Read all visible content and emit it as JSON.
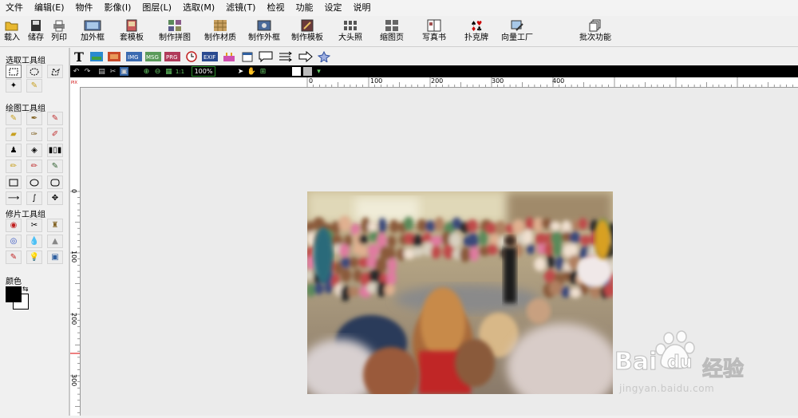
{
  "menu": [
    "文件",
    "编辑(E)",
    "物件",
    "影像(I)",
    "图层(L)",
    "选取(M)",
    "滤镜(T)",
    "检视",
    "功能",
    "设定",
    "说明"
  ],
  "toolbar": {
    "load": "载入",
    "save": "储存",
    "print": "列印",
    "add_frame": "加外框",
    "template": "套模板",
    "collage": "制作拼图",
    "material": "制作材质",
    "make_frame": "制作外框",
    "make_template": "制作模板",
    "big_head": "大头照",
    "thumbnail": "缩图页",
    "photo_book": "写真书",
    "poker": "扑克牌",
    "vector": "向量工厂",
    "batch": "批次功能"
  },
  "left_panel": {
    "select_group": "选取工具组",
    "draw_group": "绘图工具组",
    "retouch_group": "修片工具组",
    "color_label": "颜色"
  },
  "zoom_level": "100%",
  "rulers": {
    "h_ticks": [
      "0",
      "100",
      "200",
      "300",
      "400"
    ],
    "v_ticks": [
      "0",
      "100",
      "200",
      "300"
    ]
  },
  "watermark": {
    "brand_a": "Bai",
    "brand_b": "du",
    "cn": "经验",
    "url": "jingyan.baidu.com"
  },
  "colors": {
    "foreground": "#000000",
    "background": "#ffffff"
  }
}
